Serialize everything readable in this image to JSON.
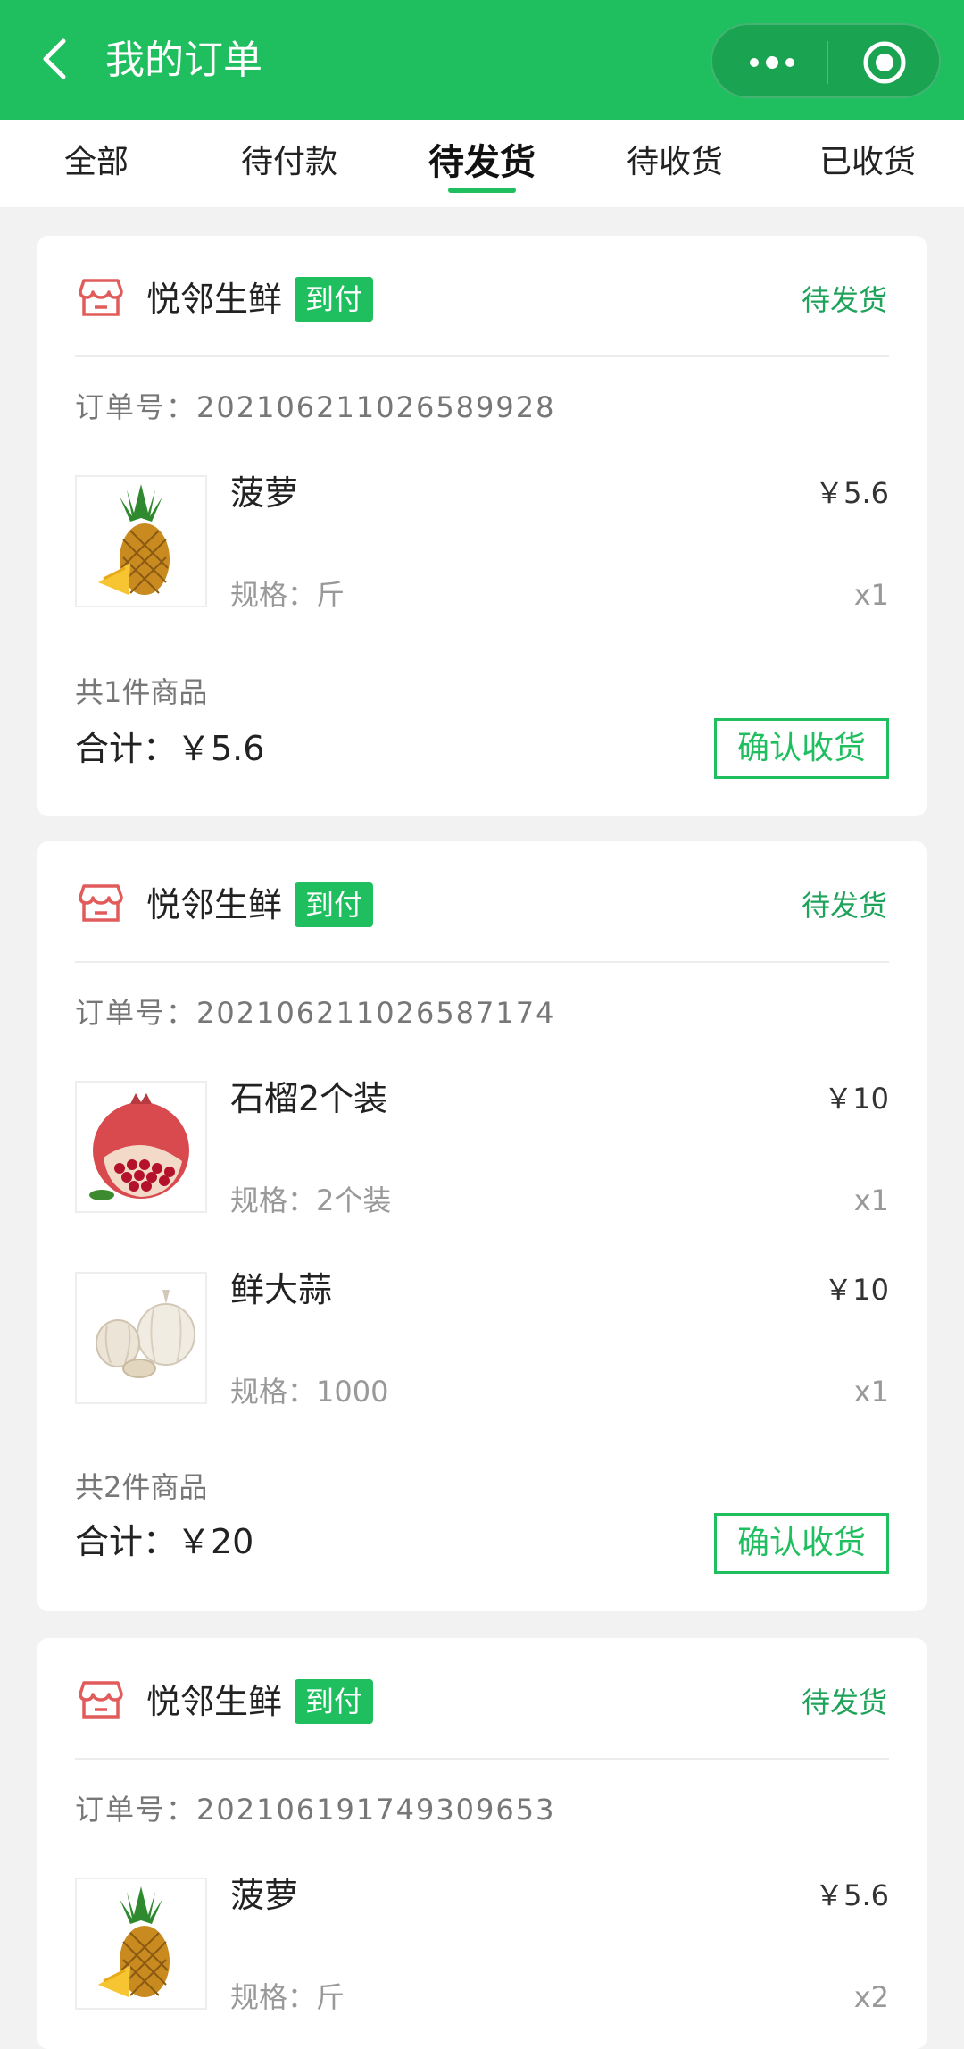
{
  "header": {
    "title": "我的订单",
    "colors": {
      "bar": "#1fbe5f",
      "accent_text": "#1fa35a"
    },
    "icons": {
      "back": "chevron-left-icon",
      "more": "more-dots-icon",
      "close": "target-close-icon"
    }
  },
  "tabs": [
    {
      "label": "全部"
    },
    {
      "label": "待付款"
    },
    {
      "label": "待发货",
      "active": true
    },
    {
      "label": "待收货"
    },
    {
      "label": "已收货"
    }
  ],
  "orders": [
    {
      "store": "悦邻生鲜",
      "pay_badge": "到付",
      "status": "待发货",
      "order_no": "订单号：202106211026589928",
      "items": [
        {
          "name": "菠萝",
          "price": "￥5.6",
          "spec": "规格：斤",
          "qty": "x1",
          "image": "pineapple"
        }
      ],
      "count": "共1件商品",
      "total": "合计：￥5.6",
      "action": "确认收货"
    },
    {
      "store": "悦邻生鲜",
      "pay_badge": "到付",
      "status": "待发货",
      "order_no": "订单号：202106211026587174",
      "items": [
        {
          "name": "石榴2个装",
          "price": "￥10",
          "spec": "规格：2个装",
          "qty": "x1",
          "image": "pomegranate"
        },
        {
          "name": "鲜大蒜",
          "price": "￥10",
          "spec": "规格：1000",
          "qty": "x1",
          "image": "garlic"
        }
      ],
      "count": "共2件商品",
      "total": "合计：￥20",
      "action": "确认收货"
    },
    {
      "store": "悦邻生鲜",
      "pay_badge": "到付",
      "status": "待发货",
      "order_no": "订单号：202106191749309653",
      "items": [
        {
          "name": "菠萝",
          "price": "￥5.6",
          "spec": "规格：斤",
          "qty": "x2",
          "image": "pineapple"
        }
      ]
    }
  ]
}
